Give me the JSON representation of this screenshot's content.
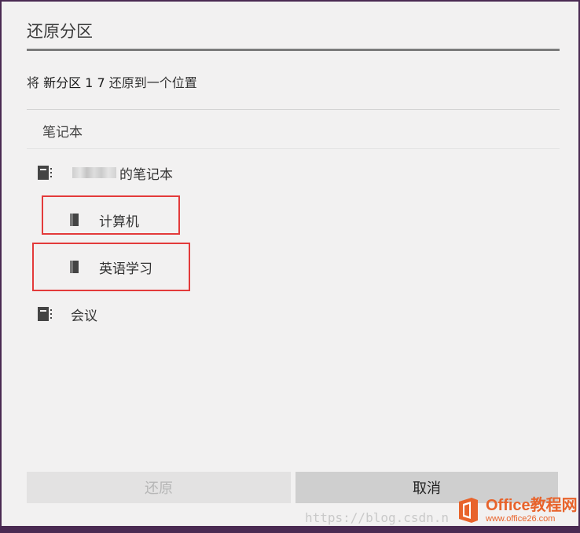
{
  "dialog": {
    "title": "还原分区",
    "prompt_prefix": "将 ",
    "prompt_section": "新分区 1 7",
    "prompt_suffix": " 还原到一个位置",
    "list_header": "笔记本"
  },
  "tree": {
    "notebook_1_suffix": "的笔记本",
    "section_1": "计算机",
    "section_2": "英语学习",
    "notebook_2": "会议"
  },
  "buttons": {
    "restore": "还原",
    "cancel": "取消"
  },
  "watermark": {
    "url": "https://blog.csdn.n",
    "logo_main": "Office教程网",
    "logo_sub": "www.office26.com"
  },
  "colors": {
    "highlight": "#e33a3a",
    "logo": "#e8632b"
  }
}
